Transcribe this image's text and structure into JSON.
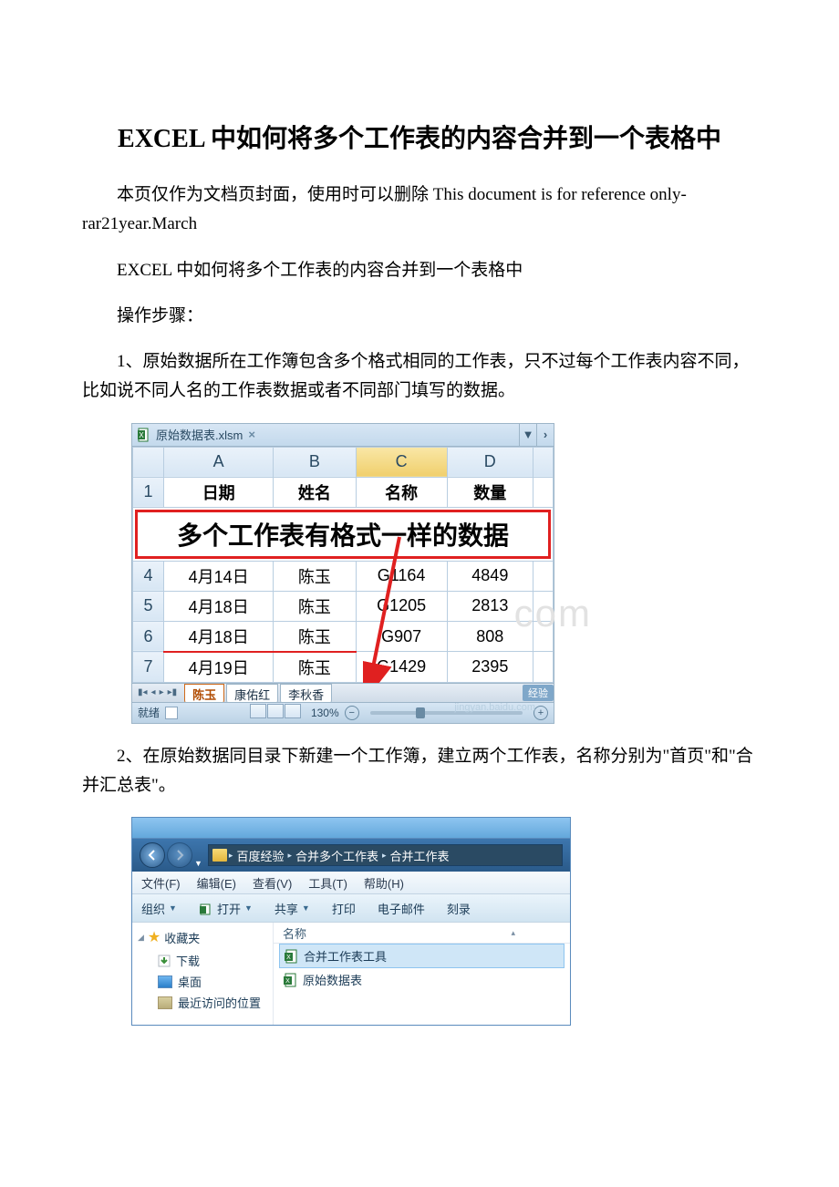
{
  "title": "EXCEL 中如何将多个工作表的内容合并到一个表格中",
  "intro": "本页仅作为文档页封面，使用时可以删除 This document is for reference only-rar21year.March",
  "line1": "EXCEL 中如何将多个工作表的内容合并到一个表格中",
  "line2": "操作步骤：",
  "step1": "1、原始数据所在工作簿包含多个格式相同的工作表，只不过每个工作表内容不同，比如说不同人名的工作表数据或者不同部门填写的数据。",
  "step2": "2、在原始数据同目录下新建一个工作簿，建立两个工作表，名称分别为\"首页\"和\"合并汇总表\"。",
  "excel": {
    "tab_name": "原始数据表.xlsm",
    "cols": [
      "A",
      "B",
      "C",
      "D"
    ],
    "headers": [
      "日期",
      "姓名",
      "名称",
      "数量"
    ],
    "banner": "多个工作表有格式一样的数据",
    "rows": [
      {
        "n": "4",
        "a": "4月14日",
        "b": "陈玉",
        "c": "G1164",
        "d": "4849"
      },
      {
        "n": "5",
        "a": "4月18日",
        "b": "陈玉",
        "c": "G1205",
        "d": "2813"
      },
      {
        "n": "6",
        "a": "4月18日",
        "b": "陈玉",
        "c": "G907",
        "d": "808"
      },
      {
        "n": "7",
        "a": "4月19日",
        "b": "陈玉",
        "c": "G1429",
        "d": "2395"
      }
    ],
    "sheets": [
      "陈玉",
      "康佑红",
      "李秋香"
    ],
    "status": "就绪",
    "zoom": "130%",
    "experience": "经验"
  },
  "explorer": {
    "crumbs": [
      "百度经验",
      "合并多个工作表",
      "合并工作表"
    ],
    "menu": [
      "文件(F)",
      "编辑(E)",
      "查看(V)",
      "工具(T)",
      "帮助(H)"
    ],
    "toolbar": {
      "organize": "组织",
      "open": "打开",
      "share": "共享",
      "print": "打印",
      "email": "电子邮件",
      "burn": "刻录"
    },
    "fav_header": "收藏夹",
    "fav_items": [
      "下载",
      "桌面",
      "最近访问的位置"
    ],
    "col_name": "名称",
    "files": [
      "合并工作表工具",
      "原始数据表"
    ]
  }
}
